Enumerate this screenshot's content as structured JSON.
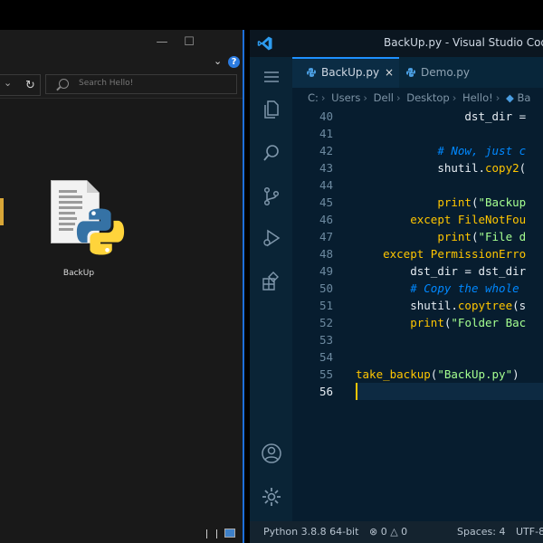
{
  "explorer": {
    "minimize": "—",
    "maximize": "☐",
    "help": "?",
    "search_placeholder": "Search Hello!",
    "file": {
      "name": "BackUp"
    }
  },
  "vscode": {
    "window_title": "BackUp.py - Visual Studio Code -",
    "tabs": [
      {
        "label": "BackUp.py",
        "close": "×"
      },
      {
        "label": "Demo.py"
      }
    ],
    "breadcrumb": [
      "C:",
      "Users",
      "Dell",
      "Desktop",
      "Hello!",
      "Ba"
    ],
    "code": [
      {
        "n": "40",
        "text": "                dst_dir ="
      },
      {
        "n": "41",
        "text": ""
      },
      {
        "n": "42",
        "text": "            # Now, just c"
      },
      {
        "n": "43",
        "text": "            shutil.copy2("
      },
      {
        "n": "44",
        "text": ""
      },
      {
        "n": "45",
        "text": "            print(\"Backup"
      },
      {
        "n": "46",
        "text": "        except FileNotFou"
      },
      {
        "n": "47",
        "text": "            print(\"File d"
      },
      {
        "n": "48",
        "text": "    except PermissionErro"
      },
      {
        "n": "49",
        "text": "        dst_dir = dst_dir"
      },
      {
        "n": "50",
        "text": "        # Copy the whole"
      },
      {
        "n": "51",
        "text": "        shutil.copytree(s"
      },
      {
        "n": "52",
        "text": "        print(\"Folder Bac"
      },
      {
        "n": "53",
        "text": ""
      },
      {
        "n": "54",
        "text": ""
      },
      {
        "n": "55",
        "text": "take_backup(\"BackUp.py\")"
      },
      {
        "n": "56",
        "text": ""
      }
    ],
    "status": {
      "interpreter": "Python 3.8.8 64-bit",
      "errors": "0",
      "warnings": "0",
      "spaces": "Spaces: 4",
      "encoding": "UTF-8"
    }
  },
  "colors": {
    "keyword": "#ffc600",
    "string": "#a5ff90",
    "comment": "#0088ff",
    "accent": "#1e6fd9"
  }
}
